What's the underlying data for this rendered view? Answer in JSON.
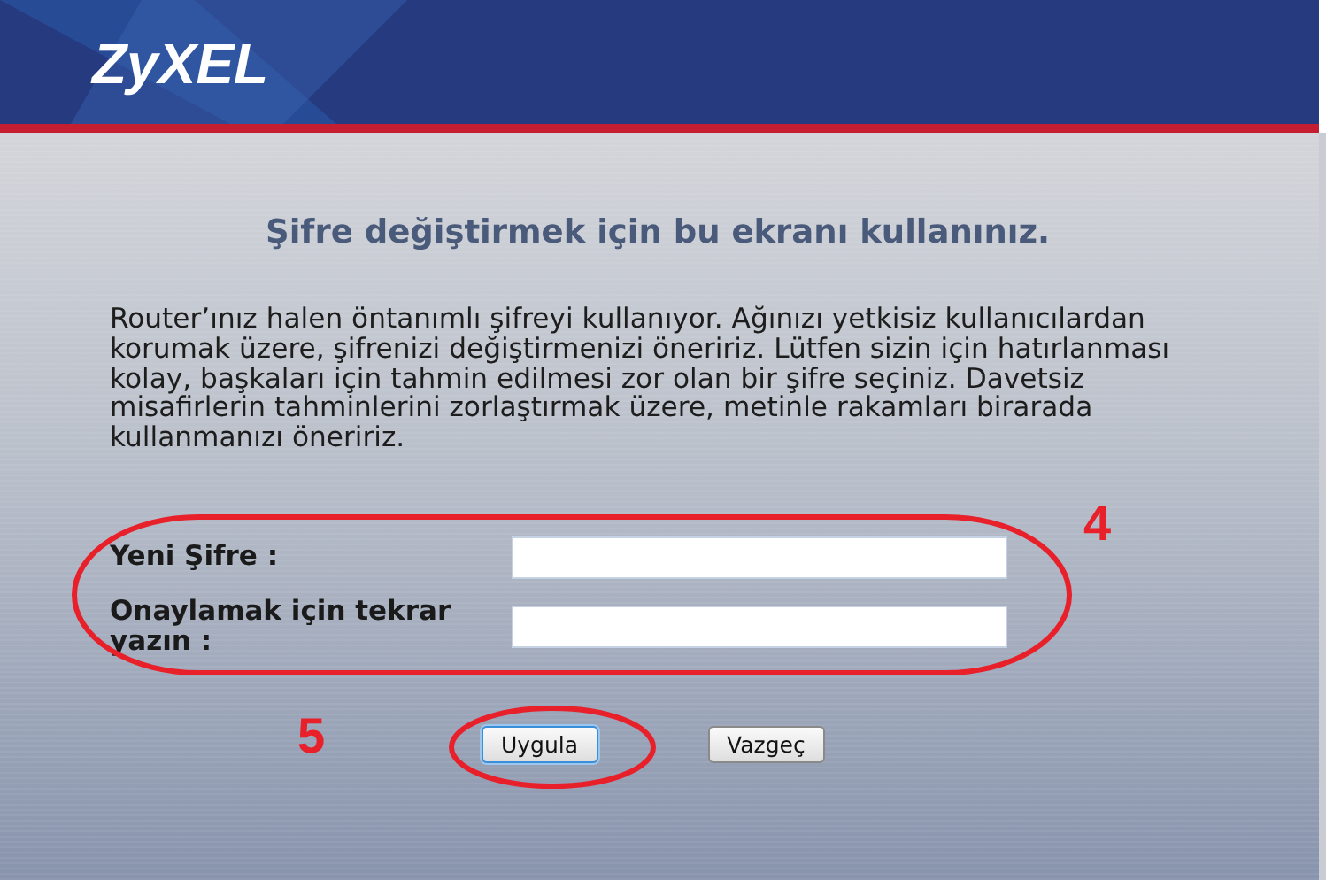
{
  "header": {
    "logo": "ZyXEL"
  },
  "title": "Şifre değiştirmek için bu ekranı kullanınız.",
  "description": "Router’ınız halen öntanımlı şifreyi kullanıyor. Ağınızı yetkisiz kullanıcılardan korumak üzere, şifrenizi değiştirmenizi öneririz. Lütfen sizin için hatırlanması kolay, başkaları için tahmin edilmesi zor olan bir şifre seçiniz. Davetsiz misafirlerin tahminlerini zorlaştırmak üzere, metinle rakamları birarada kullanmanızı öneririz.",
  "fields": [
    {
      "label": "Yeni Şifre :"
    },
    {
      "label": "Onaylamak için tekrar yazın :"
    }
  ],
  "buttons": [
    {
      "label": "Uygula",
      "focused": true
    },
    {
      "label": "Vazgeç",
      "focused": false
    }
  ],
  "annotations": [
    {
      "label": "4"
    },
    {
      "label": "5"
    }
  ]
}
